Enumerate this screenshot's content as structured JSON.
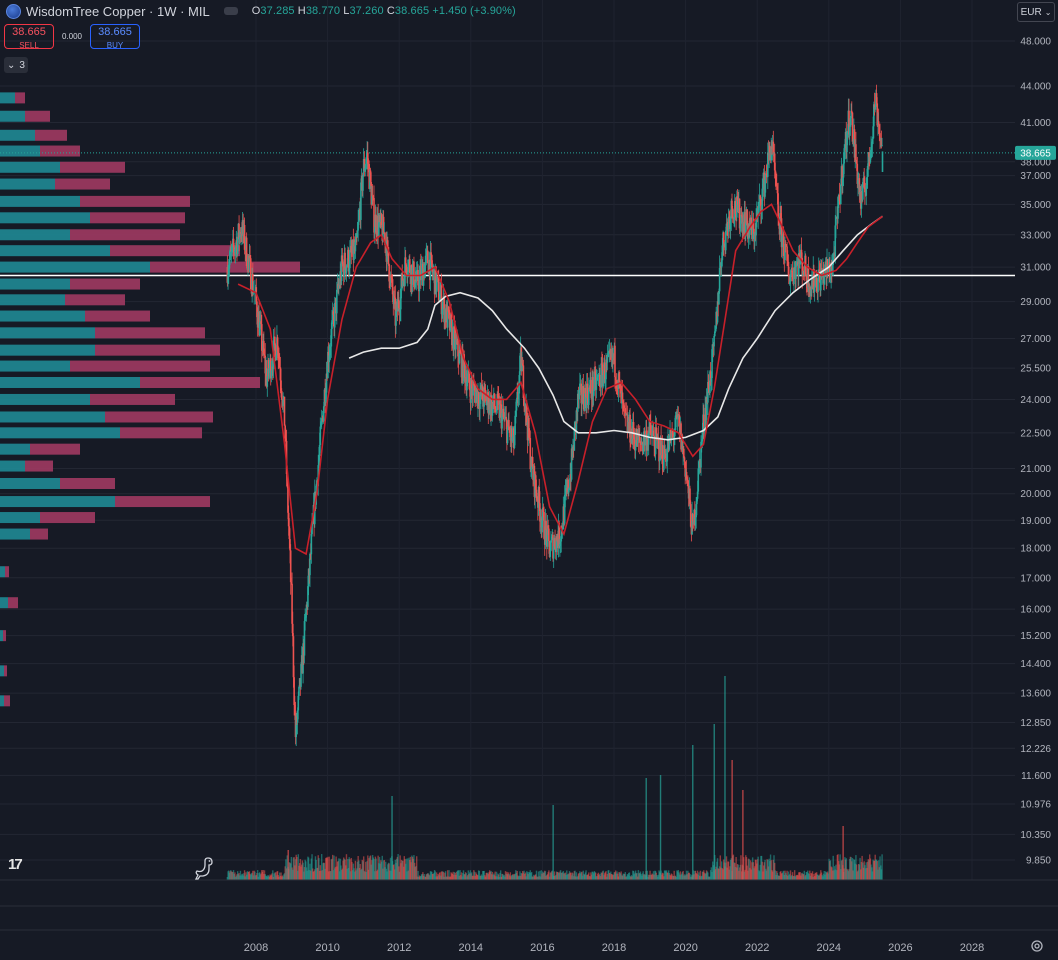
{
  "header": {
    "title": "WisdomTree Copper · 1W · MIL",
    "o_label": "O",
    "o_value": "37.285",
    "h_label": "H",
    "h_value": "38.770",
    "l_label": "L",
    "l_value": "37.260",
    "c_label": "C",
    "c_value": "38.665",
    "change": "+1.450 (+3.90%)"
  },
  "trade": {
    "sell_price": "38.665",
    "sell_label": "SELL",
    "spread": "0.000",
    "buy_price": "38.665",
    "buy_label": "BUY"
  },
  "indicators_toggle": "3",
  "currency": "EUR",
  "colors": {
    "up": "#26a69a",
    "down": "#ef5350",
    "profile_up": "#1f8a95",
    "profile_down": "#a03a62",
    "ma_fast": "#c8202a",
    "ma_slow": "#e8e8e8",
    "price_badge": "#26a69a"
  },
  "chart_data": {
    "type": "line",
    "title": "",
    "scale": "log",
    "ylim": [
      9.5,
      50
    ],
    "xlim": [
      2006.5,
      2029.2
    ],
    "current_price": 38.665,
    "current_price_label": "38.665",
    "y_ticks": [
      "48.000",
      "44.000",
      "41.000",
      "38.000",
      "37.000",
      "35.000",
      "33.000",
      "31.000",
      "29.000",
      "27.000",
      "25.500",
      "24.000",
      "22.500",
      "21.000",
      "20.000",
      "19.000",
      "18.000",
      "17.000",
      "16.000",
      "15.200",
      "14.400",
      "13.600",
      "12.850",
      "12.226",
      "11.600",
      "10.976",
      "10.350",
      "9.850"
    ],
    "x_ticks": [
      "2008",
      "2010",
      "2012",
      "2014",
      "2016",
      "2018",
      "2020",
      "2022",
      "2024",
      "2026",
      "2028"
    ],
    "horizontal_level": 30.5,
    "series": [
      {
        "type": "price",
        "x": [
          2007.2,
          2007.6,
          2008.0,
          2008.3,
          2008.6,
          2008.8,
          2009.0,
          2009.1,
          2009.3,
          2009.6,
          2010.0,
          2010.4,
          2010.8,
          2011.0,
          2011.1,
          2011.3,
          2011.6,
          2011.9,
          2012.2,
          2012.5,
          2012.8,
          2013.2,
          2013.6,
          2014.0,
          2014.4,
          2014.8,
          2015.2,
          2015.4,
          2015.7,
          2016.0,
          2016.2,
          2016.5,
          2016.8,
          2017.0,
          2017.4,
          2017.8,
          2018.0,
          2018.3,
          2018.7,
          2019.0,
          2019.4,
          2019.8,
          2020.0,
          2020.2,
          2020.5,
          2020.8,
          2021.0,
          2021.3,
          2021.6,
          2021.9,
          2022.2,
          2022.4,
          2022.6,
          2022.9,
          2023.2,
          2023.5,
          2023.8,
          2024.1,
          2024.4,
          2024.6,
          2024.9,
          2025.1,
          2025.3,
          2025.5
        ],
        "values": [
          31.0,
          33.5,
          29.0,
          25.0,
          27.0,
          23.0,
          16.0,
          12.5,
          14.5,
          19.0,
          26.0,
          31.0,
          32.0,
          37.5,
          38.5,
          34.0,
          33.0,
          28.0,
          31.5,
          30.0,
          31.5,
          29.0,
          26.5,
          24.5,
          24.0,
          23.5,
          22.0,
          26.0,
          21.0,
          19.0,
          18.0,
          18.5,
          21.0,
          24.0,
          24.5,
          25.5,
          26.0,
          23.0,
          22.0,
          22.5,
          21.5,
          23.0,
          21.0,
          18.5,
          23.0,
          26.5,
          32.0,
          35.0,
          34.0,
          33.0,
          36.5,
          39.5,
          34.0,
          30.5,
          31.5,
          30.0,
          30.5,
          31.0,
          38.0,
          42.0,
          35.0,
          37.5,
          43.0,
          38.665
        ]
      },
      {
        "type": "ma",
        "name": "",
        "x": [
          2007.5,
          2008.0,
          2008.4,
          2008.8,
          2009.1,
          2009.4,
          2009.7,
          2010.0,
          2010.4,
          2010.8,
          2011.2,
          2011.5,
          2011.8,
          2012.2,
          2012.6,
          2013.0,
          2013.4,
          2013.8,
          2014.2,
          2014.6,
          2015.0,
          2015.4,
          2015.8,
          2016.2,
          2016.6,
          2017.0,
          2017.4,
          2017.8,
          2018.2,
          2018.6,
          2019.0,
          2019.4,
          2019.8,
          2020.2,
          2020.5,
          2020.8,
          2021.1,
          2021.4,
          2021.8,
          2022.1,
          2022.4,
          2022.7,
          2023.0,
          2023.4,
          2023.8,
          2024.2,
          2024.5,
          2024.8,
          2025.1,
          2025.5
        ],
        "values": [
          30.0,
          29.5,
          27.5,
          22.0,
          18.0,
          17.8,
          20.0,
          24.0,
          28.0,
          31.0,
          32.5,
          33.0,
          31.5,
          30.5,
          30.5,
          31.0,
          29.0,
          26.0,
          24.5,
          24.0,
          24.0,
          24.8,
          22.5,
          19.5,
          18.5,
          20.5,
          23.0,
          24.5,
          24.8,
          24.0,
          23.0,
          22.8,
          22.5,
          21.5,
          22.0,
          24.5,
          28.0,
          32.0,
          33.5,
          34.5,
          35.0,
          33.5,
          32.0,
          31.0,
          30.5,
          30.8,
          31.5,
          32.5,
          33.5,
          34.2
        ]
      },
      {
        "type": "ma",
        "name": "",
        "x": [
          2010.6,
          2011.0,
          2011.5,
          2012.0,
          2012.5,
          2012.8,
          2013.0,
          2013.3,
          2013.7,
          2014.2,
          2014.6,
          2015.0,
          2015.5,
          2015.9,
          2016.3,
          2016.6,
          2017.0,
          2017.5,
          2018.0,
          2018.5,
          2019.0,
          2019.5,
          2020.0,
          2020.5,
          2020.9,
          2021.2,
          2021.6,
          2022.0,
          2022.5,
          2023.0,
          2023.5,
          2024.0,
          2024.4,
          2024.8,
          2025.2,
          2025.5
        ],
        "values": [
          26.0,
          26.3,
          26.5,
          26.5,
          26.8,
          27.5,
          28.8,
          29.3,
          29.5,
          29.2,
          28.5,
          27.5,
          26.5,
          25.5,
          24.2,
          23.0,
          22.5,
          22.5,
          22.6,
          22.5,
          22.3,
          22.2,
          22.3,
          22.6,
          23.2,
          24.5,
          26.0,
          27.0,
          28.5,
          29.5,
          30.3,
          31.0,
          32.0,
          33.0,
          33.7,
          34.2
        ]
      }
    ],
    "volume_profile": [
      {
        "price": 43.0,
        "up": 15,
        "down": 10
      },
      {
        "price": 41.5,
        "up": 25,
        "down": 25
      },
      {
        "price": 40.0,
        "up": 35,
        "down": 32
      },
      {
        "price": 38.8,
        "up": 40,
        "down": 40
      },
      {
        "price": 37.6,
        "up": 60,
        "down": 65
      },
      {
        "price": 36.4,
        "up": 55,
        "down": 55
      },
      {
        "price": 35.2,
        "up": 80,
        "down": 110
      },
      {
        "price": 34.1,
        "up": 90,
        "down": 95
      },
      {
        "price": 33.0,
        "up": 70,
        "down": 110
      },
      {
        "price": 32.0,
        "up": 110,
        "down": 130
      },
      {
        "price": 31.0,
        "up": 150,
        "down": 150
      },
      {
        "price": 30.0,
        "up": 70,
        "down": 70
      },
      {
        "price": 29.1,
        "up": 65,
        "down": 60
      },
      {
        "price": 28.2,
        "up": 85,
        "down": 65
      },
      {
        "price": 27.3,
        "up": 95,
        "down": 110
      },
      {
        "price": 26.4,
        "up": 95,
        "down": 125
      },
      {
        "price": 25.6,
        "up": 70,
        "down": 140
      },
      {
        "price": 24.8,
        "up": 140,
        "down": 120
      },
      {
        "price": 24.0,
        "up": 90,
        "down": 85
      },
      {
        "price": 23.2,
        "up": 105,
        "down": 108
      },
      {
        "price": 22.5,
        "up": 120,
        "down": 82
      },
      {
        "price": 21.8,
        "up": 30,
        "down": 50
      },
      {
        "price": 21.1,
        "up": 25,
        "down": 28
      },
      {
        "price": 20.4,
        "up": 60,
        "down": 55
      },
      {
        "price": 19.7,
        "up": 115,
        "down": 95
      },
      {
        "price": 19.1,
        "up": 40,
        "down": 55
      },
      {
        "price": 18.5,
        "up": 30,
        "down": 18
      },
      {
        "price": 17.2,
        "up": 5,
        "down": 4
      },
      {
        "price": 16.2,
        "up": 8,
        "down": 10
      },
      {
        "price": 15.2,
        "up": 3,
        "down": 3
      },
      {
        "price": 14.2,
        "up": 4,
        "down": 3
      },
      {
        "price": 13.4,
        "up": 4,
        "down": 6
      }
    ]
  },
  "volume": {
    "spikes": [
      {
        "x": 2008.9,
        "v": 10,
        "up": false
      },
      {
        "x": 2011.8,
        "v": 28,
        "up": true
      },
      {
        "x": 2016.3,
        "v": 25,
        "up": true
      },
      {
        "x": 2018.9,
        "v": 34,
        "up": true
      },
      {
        "x": 2019.3,
        "v": 35,
        "up": true
      },
      {
        "x": 2020.2,
        "v": 45,
        "up": true
      },
      {
        "x": 2020.8,
        "v": 52,
        "up": true
      },
      {
        "x": 2021.1,
        "v": 68,
        "up": true
      },
      {
        "x": 2021.3,
        "v": 40,
        "up": false
      },
      {
        "x": 2021.6,
        "v": 30,
        "up": false
      },
      {
        "x": 2024.4,
        "v": 18,
        "up": false
      }
    ]
  }
}
